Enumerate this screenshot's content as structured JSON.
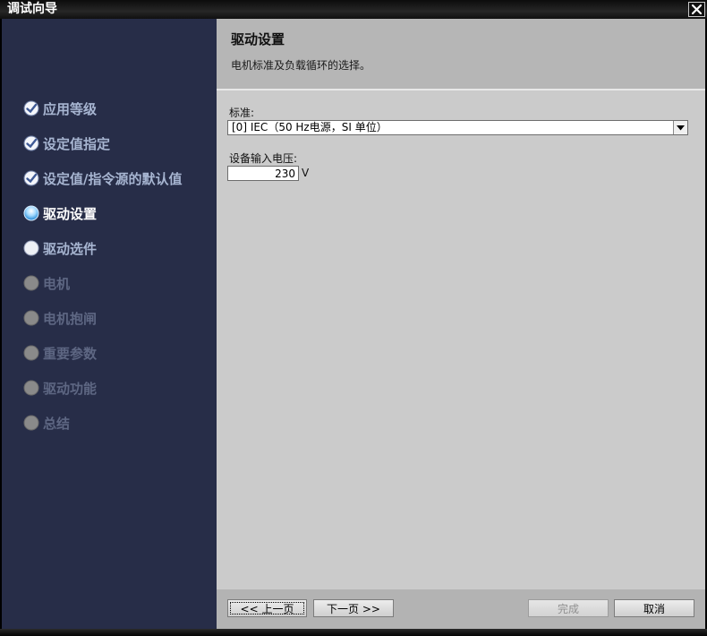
{
  "window": {
    "title": "调试向导",
    "close_icon": "close-icon"
  },
  "sidebar": {
    "steps": [
      {
        "label": "应用等级",
        "state": "done",
        "icon": "check-circle-icon"
      },
      {
        "label": "设定值指定",
        "state": "done",
        "icon": "check-circle-icon"
      },
      {
        "label": "设定值/指令源的默认值",
        "state": "done",
        "icon": "check-circle-icon"
      },
      {
        "label": "驱动设置",
        "state": "current",
        "icon": "current-step-icon"
      },
      {
        "label": "驱动选件",
        "state": "pending",
        "icon": "step-circle-icon"
      },
      {
        "label": "电机",
        "state": "disabled",
        "icon": "step-circle-icon"
      },
      {
        "label": "电机抱闸",
        "state": "disabled",
        "icon": "step-circle-icon"
      },
      {
        "label": "重要参数",
        "state": "disabled",
        "icon": "step-circle-icon"
      },
      {
        "label": "驱动功能",
        "state": "disabled",
        "icon": "step-circle-icon"
      },
      {
        "label": "总结",
        "state": "disabled",
        "icon": "step-circle-icon"
      }
    ]
  },
  "header": {
    "title": "驱动设置",
    "subtitle": "电机标准及负载循环的选择。"
  },
  "form": {
    "standard_label": "标准:",
    "standard_value": "[0] IEC（50 Hz电源，SI 单位）",
    "voltage_label": "设备输入电压:",
    "voltage_value": "230",
    "voltage_unit": "V"
  },
  "footer": {
    "prev_label": "<< 上一页",
    "next_label": "下一页 >>",
    "finish_label": "完成",
    "cancel_label": "取消"
  },
  "colors": {
    "sidebar_bg": "#272d48",
    "header_bg": "#b6b6b6",
    "content_bg": "#cbcbcb",
    "step_done_text": "#a7b5d1",
    "step_current_text": "#ffffff",
    "step_disabled_text": "#5e6783"
  }
}
